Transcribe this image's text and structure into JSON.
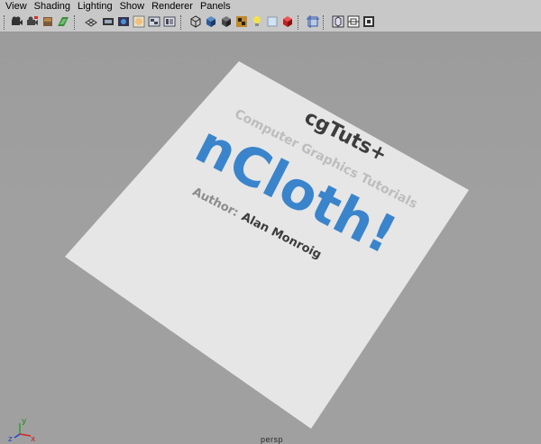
{
  "menu": {
    "items": [
      "View",
      "Shading",
      "Lighting",
      "Show",
      "Renderer",
      "Panels"
    ]
  },
  "toolbar": {
    "icons": [
      "select-camera-icon",
      "camera-attributes-icon",
      "bookmark-icon",
      "image-plane-icon",
      "grid-icon",
      "film-gate-icon",
      "resolution-gate-icon",
      "gate-mask-icon",
      "field-chart-icon",
      "safe-action-icon",
      "wireframe-icon",
      "smooth-shade-icon",
      "shaded-wireframe-icon",
      "textured-icon",
      "use-lights-icon",
      "shadows-icon",
      "xray-icon",
      "isolate-select-icon",
      "xray-joints-icon",
      "wireframe-on-shaded-icon",
      "backface-icon"
    ]
  },
  "viewport": {
    "title": "cgTuts+",
    "subtitle": "Computer Graphics Tutorials",
    "headline": "nCloth!",
    "author_label": "Author:",
    "author_name": "Alan Monroig",
    "camera_label": "persp",
    "axis": {
      "x": "x",
      "y": "y",
      "z": "z"
    },
    "colors": {
      "background": "#a0a0a0",
      "plane": "#e6e6e6",
      "headline": "#3a84cc",
      "title": "#3d3d3d",
      "subtitle": "#bdbdbd",
      "author_label": "#8c8c8c",
      "author_name": "#3d3d3d"
    }
  }
}
